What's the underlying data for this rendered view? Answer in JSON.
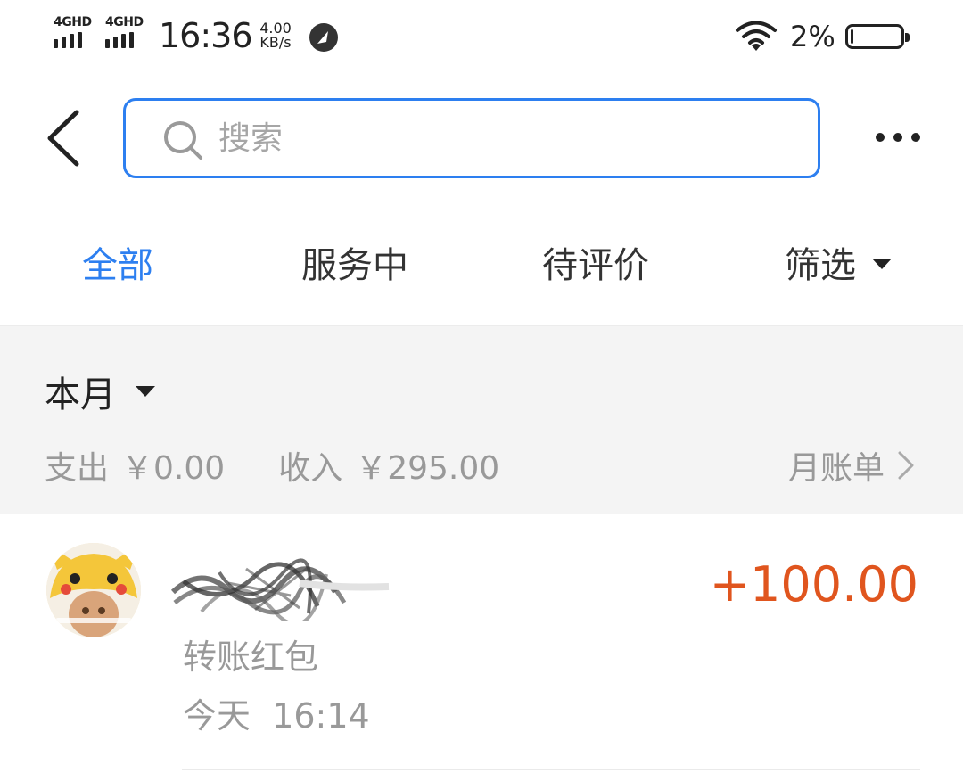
{
  "status_bar": {
    "sim1_label": "4GHD",
    "sim2_label": "4GHD",
    "time": "16:36",
    "net_speed_value": "4.00",
    "net_speed_unit": "KB/s",
    "battery_percent": "2%",
    "battery_level": 0.02
  },
  "header": {
    "search_placeholder": "搜索"
  },
  "tabs": [
    {
      "label": "全部",
      "active": true
    },
    {
      "label": "服务中",
      "active": false
    },
    {
      "label": "待评价",
      "active": false
    },
    {
      "label": "筛选",
      "active": false
    }
  ],
  "summary": {
    "month_label": "本月",
    "expense_label": "支出",
    "expense_value": "￥0.00",
    "income_label": "收入",
    "income_value": "￥295.00",
    "bill_link": "月账单"
  },
  "transactions": [
    {
      "type": "转账红包",
      "date_label": "今天",
      "time": "16:14",
      "amount": "+100.00"
    }
  ],
  "colors": {
    "accent": "#2d7ff0",
    "amount": "#e0551e",
    "muted_text": "#999999",
    "summary_bg": "#f4f4f4"
  },
  "icons": [
    "back-arrow-icon",
    "search-icon",
    "more-icon",
    "dropdown-caret-icon",
    "chevron-right-icon",
    "wifi-icon",
    "battery-icon",
    "speed-gauge-icon"
  ]
}
